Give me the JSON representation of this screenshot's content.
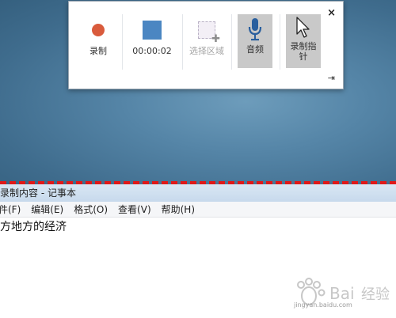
{
  "toolbar": {
    "record_label": "录制",
    "timer": "00:00:02",
    "select_area_label": "选择区域",
    "audio_label": "音频",
    "pointer_label": "录制指针",
    "close": "×"
  },
  "notepad": {
    "title": "录制内容 - 记事本",
    "menu": [
      "件(F)",
      "编辑(E)",
      "格式(O)",
      "查看(V)",
      "帮助(H)"
    ],
    "content": "方地方的经济"
  },
  "watermark": {
    "text": "jingyan.baidu.com"
  },
  "colors": {
    "record_dot": "#d95b3c",
    "stop_square": "#4b86c2",
    "separator": "#e01818"
  }
}
